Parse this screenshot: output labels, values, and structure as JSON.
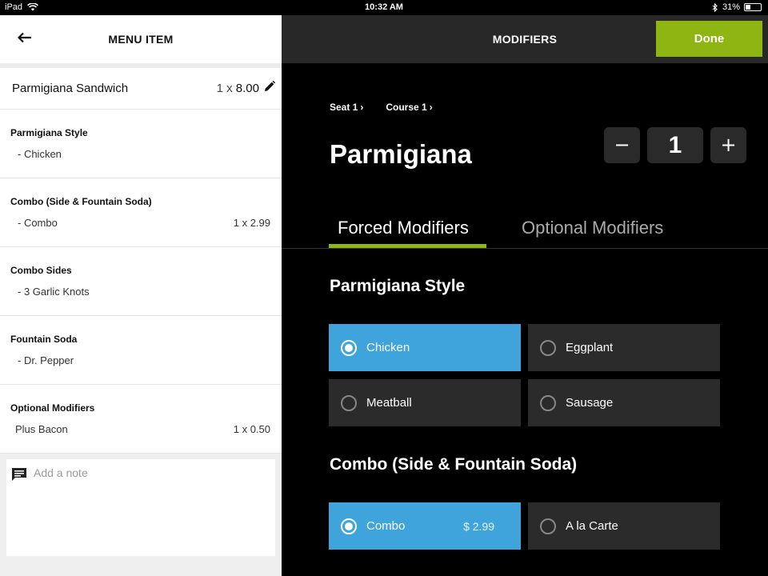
{
  "status_bar": {
    "device": "iPad",
    "time": "10:32 AM",
    "battery": "31%"
  },
  "left_panel": {
    "title": "MENU ITEM",
    "item": {
      "name": "Parmigiana Sandwich",
      "qty_prefix": "1 x",
      "price": "8.00"
    },
    "modifier_groups": [
      {
        "title": "Parmigiana Style",
        "value": "- Chicken",
        "price": ""
      },
      {
        "title": "Combo (Side & Fountain Soda)",
        "value": "- Combo",
        "price": "1 x 2.99"
      },
      {
        "title": "Combo Sides",
        "value": "- 3 Garlic Knots",
        "price": ""
      },
      {
        "title": "Fountain Soda",
        "value": "- Dr. Pepper",
        "price": ""
      },
      {
        "title": "Optional Modifiers",
        "value": "Plus Bacon",
        "price": "1 x 0.50"
      }
    ],
    "note_placeholder": "Add a note"
  },
  "right_panel": {
    "title": "MODIFIERS",
    "done_label": "Done",
    "breadcrumbs": [
      "Seat 1",
      "Course 1"
    ],
    "product_title": "Parmigiana",
    "quantity": "1",
    "minus_label": "−",
    "plus_label": "+",
    "tabs": [
      {
        "label": "Forced Modifiers",
        "active": true
      },
      {
        "label": "Optional Modifiers",
        "active": false
      }
    ],
    "sections": [
      {
        "title": "Parmigiana Style",
        "options": [
          {
            "label": "Chicken",
            "selected": true,
            "price": ""
          },
          {
            "label": "Eggplant",
            "selected": false,
            "price": ""
          },
          {
            "label": "Meatball",
            "selected": false,
            "price": ""
          },
          {
            "label": "Sausage",
            "selected": false,
            "price": ""
          }
        ]
      },
      {
        "title": "Combo (Side & Fountain Soda)",
        "options": [
          {
            "label": "Combo",
            "selected": true,
            "price": "$ 2.99"
          },
          {
            "label": "A la Carte",
            "selected": false,
            "price": ""
          }
        ]
      }
    ]
  },
  "colors": {
    "accent_green": "#8fb512",
    "selected_blue": "#3fa4dc",
    "dark_button": "#2b2b2b"
  },
  "icons": {
    "back": "arrow-left-icon",
    "edit": "pencil-icon",
    "note": "chat-bubble-icon",
    "wifi": "wifi-icon",
    "bluetooth": "bluetooth-icon"
  }
}
